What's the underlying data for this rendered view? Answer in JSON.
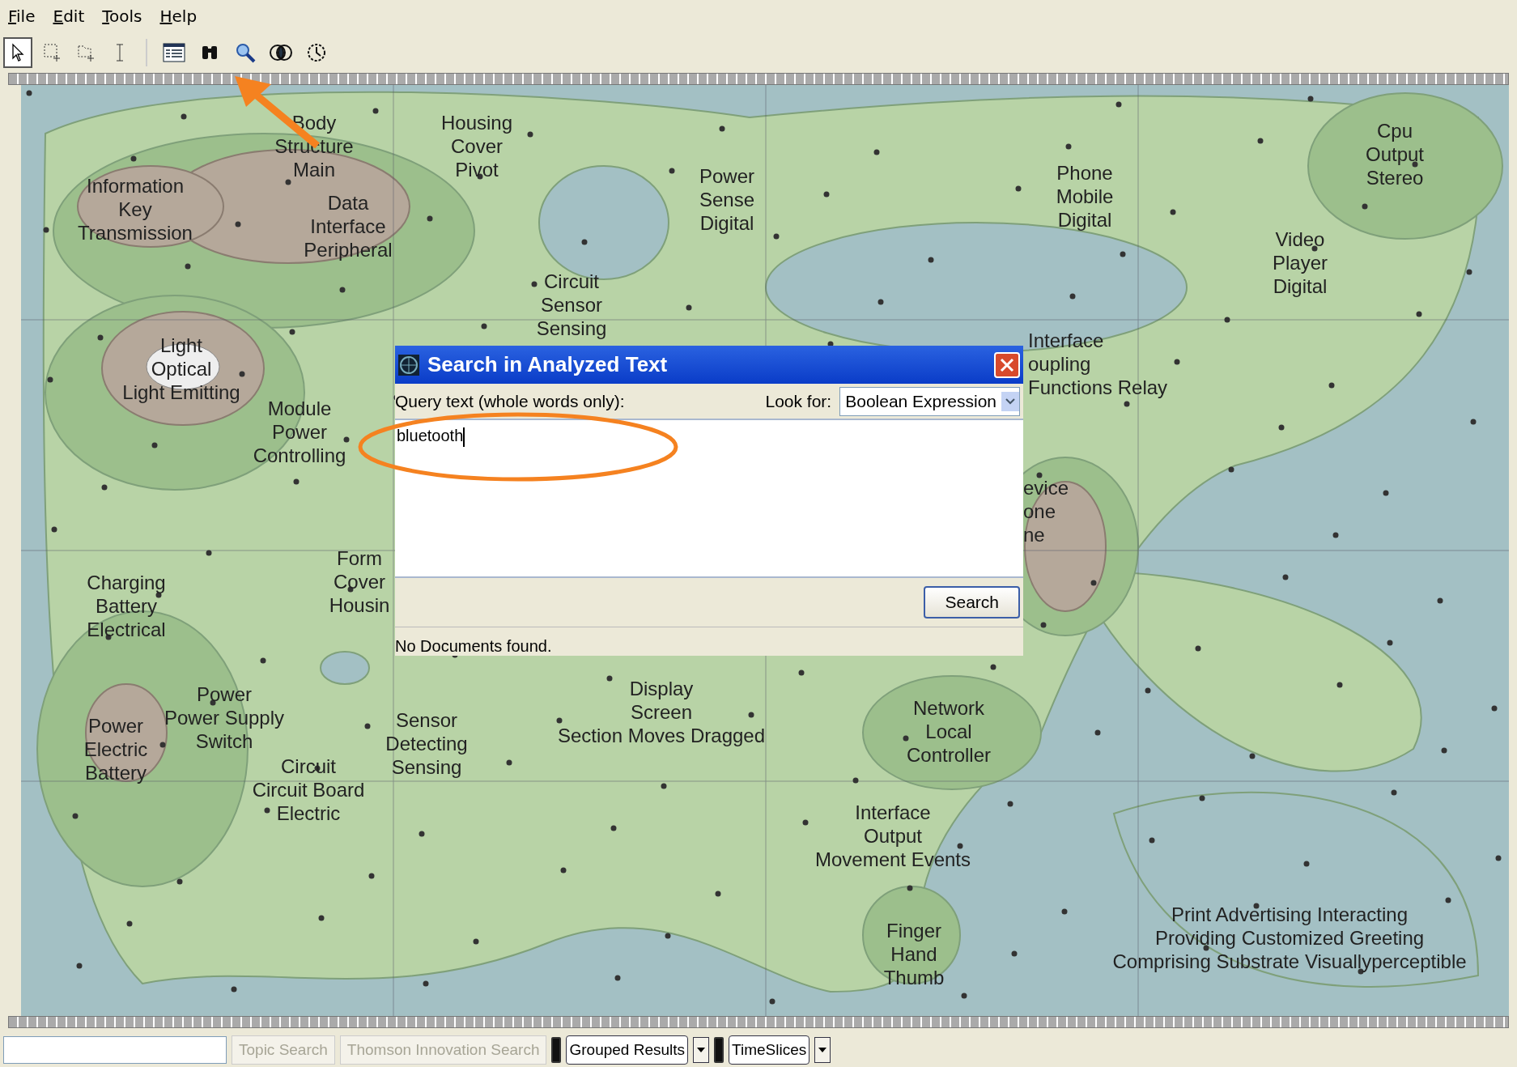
{
  "menu": [
    {
      "label": "File"
    },
    {
      "label": "Edit"
    },
    {
      "label": "Tools"
    },
    {
      "label": "Help"
    }
  ],
  "toolbar": {
    "tools": [
      {
        "kind": "pointer",
        "selected": true
      },
      {
        "kind": "rect-select",
        "selected": false
      },
      {
        "kind": "lasso-select",
        "selected": false
      },
      {
        "kind": "text-cursor",
        "selected": false
      }
    ],
    "buttons": [
      {
        "kind": "list"
      },
      {
        "kind": "binoculars"
      },
      {
        "kind": "magnifier"
      },
      {
        "kind": "overlap"
      },
      {
        "kind": "clock"
      }
    ]
  },
  "map": {
    "labels": [
      {
        "lines": [
          "Body",
          "Structure",
          "Main"
        ]
      },
      {
        "lines": [
          "Housing",
          "Cover",
          "Pivot"
        ]
      },
      {
        "lines": [
          "Information",
          "Key",
          "Transmission"
        ]
      },
      {
        "lines": [
          "Data",
          "Interface",
          "Peripheral"
        ]
      },
      {
        "lines": [
          "Power",
          "Sense",
          "Digital"
        ]
      },
      {
        "lines": [
          "Phone",
          "Mobile",
          "Digital"
        ]
      },
      {
        "lines": [
          "Cpu",
          "Output",
          "Stereo"
        ]
      },
      {
        "lines": [
          "Video",
          "Player",
          "Digital"
        ]
      },
      {
        "lines": [
          "Circuit",
          "Sensor",
          "Sensing"
        ]
      },
      {
        "lines": [
          "Light",
          "Optical",
          "Light Emitting"
        ]
      },
      {
        "lines": [
          "Module",
          "Power",
          "Controlling"
        ]
      },
      {
        "lines": [
          "Interface",
          "oupling",
          "Functions Relay"
        ]
      },
      {
        "lines": [
          "evice",
          "one",
          "ne"
        ]
      },
      {
        "lines": [
          "Charging",
          "Battery",
          "Electrical"
        ]
      },
      {
        "lines": [
          "Form",
          "Cover",
          "Housin"
        ]
      },
      {
        "lines": [
          "Power",
          "Power Supply",
          "Switch"
        ]
      },
      {
        "lines": [
          "Power",
          "Electric",
          "Battery"
        ]
      },
      {
        "lines": [
          "Display",
          "Screen",
          "Section Moves Dragged"
        ]
      },
      {
        "lines": [
          "Sensor",
          "Detecting",
          "Sensing"
        ]
      },
      {
        "lines": [
          "Circuit",
          "Circuit Board",
          "Electric"
        ]
      },
      {
        "lines": [
          "Network",
          "Local",
          "Controller"
        ]
      },
      {
        "lines": [
          "Interface",
          "Output",
          "Movement Events"
        ]
      },
      {
        "lines": [
          "Finger",
          "Hand",
          "Thumb"
        ]
      },
      {
        "lines": [
          "Print Advertising Interacting",
          "Providing Customized Greeting",
          "Comprising Substrate Visuallyperceptible"
        ]
      }
    ]
  },
  "dialog": {
    "title": "Search in Analyzed Text",
    "query_label": "Query text (whole words only):",
    "look_for_label": "Look for:",
    "look_for_value": "Boolean Expression",
    "query": "bluetooth",
    "button": "Search",
    "status": "No Documents found."
  },
  "bottom_bar": {
    "buttons": [
      {
        "label": "Topic Search",
        "disabled": true
      },
      {
        "label": "Thomson Innovation Search",
        "disabled": true
      }
    ],
    "dropdowns": [
      {
        "label": "Grouped Results"
      },
      {
        "label": "TimeSlices"
      }
    ]
  }
}
